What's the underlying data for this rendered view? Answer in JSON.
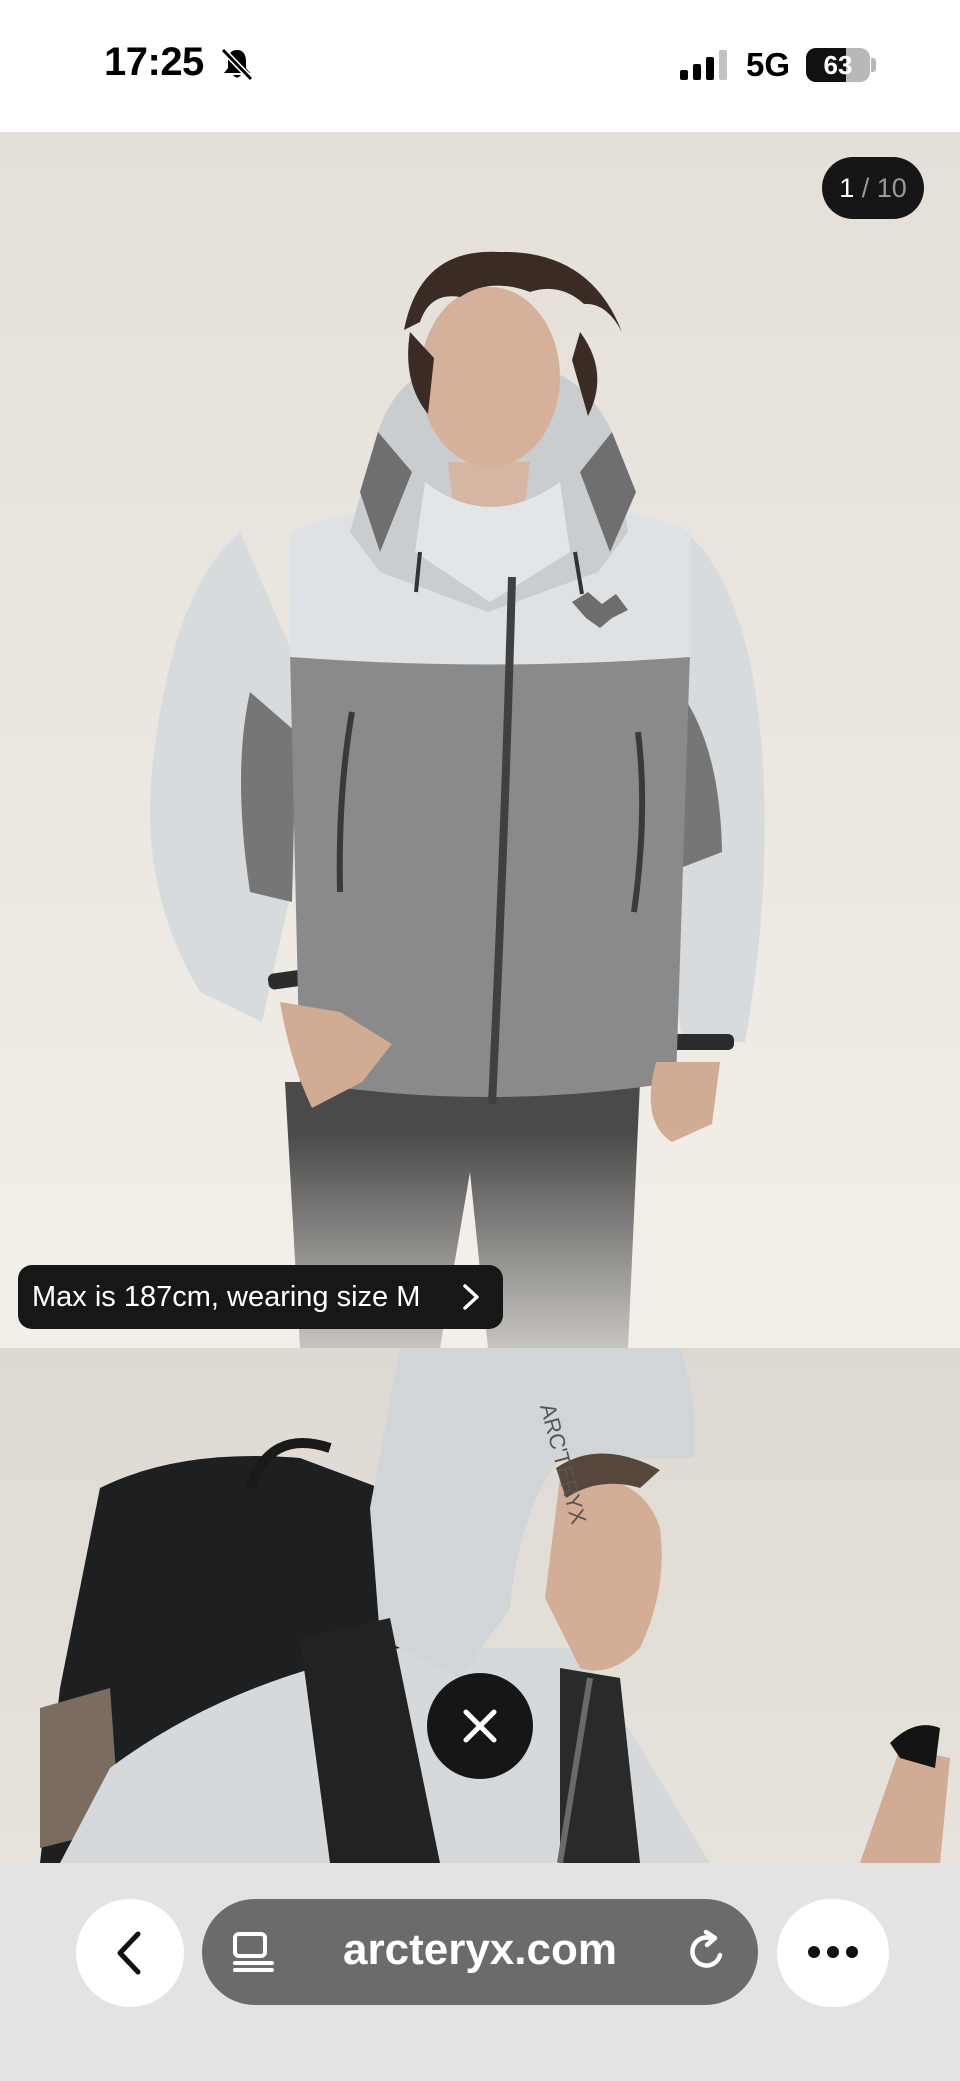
{
  "status_bar": {
    "time": "17:25",
    "network": "5G",
    "battery": "63",
    "battery_level": 0.63
  },
  "gallery": {
    "counter": {
      "current": "1",
      "separator": "/",
      "total": "10"
    },
    "size_info": "Max is 187cm, wearing size M",
    "images": [
      {
        "icon": "model-front-photo"
      },
      {
        "icon": "model-hood-backpack-photo"
      }
    ]
  },
  "browser": {
    "url": "arcteryx.com",
    "icons": {
      "back": "chevron-left-icon",
      "page_menu": "page-menu-icon",
      "reload": "reload-icon",
      "more": "more-icon",
      "close": "close-icon"
    }
  }
}
